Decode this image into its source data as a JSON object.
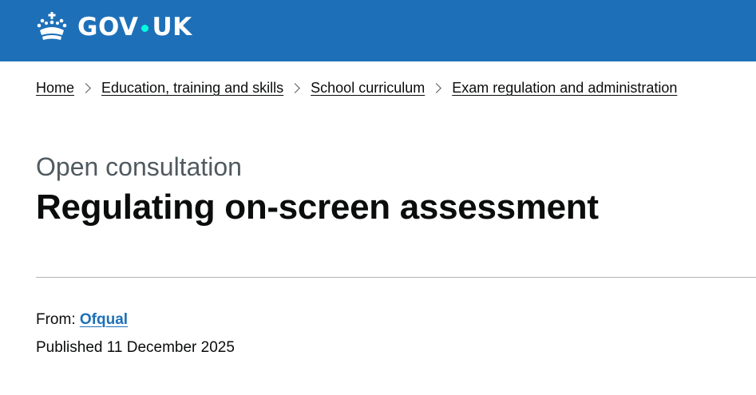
{
  "header": {
    "logo_left": "GOV",
    "logo_right": "UK",
    "logo_icon": "crown-icon",
    "accent_color": "#1d70b8",
    "dot_color": "#00ffe0"
  },
  "breadcrumbs": [
    {
      "label": "Home"
    },
    {
      "label": "Education, training and skills"
    },
    {
      "label": "School curriculum"
    },
    {
      "label": "Exam regulation and administration"
    }
  ],
  "page": {
    "caption": "Open consultation",
    "title": "Regulating on-screen assessment"
  },
  "meta": {
    "from_label": "From:",
    "from_org": "Ofqual",
    "published": "Published 11 December 2025"
  }
}
